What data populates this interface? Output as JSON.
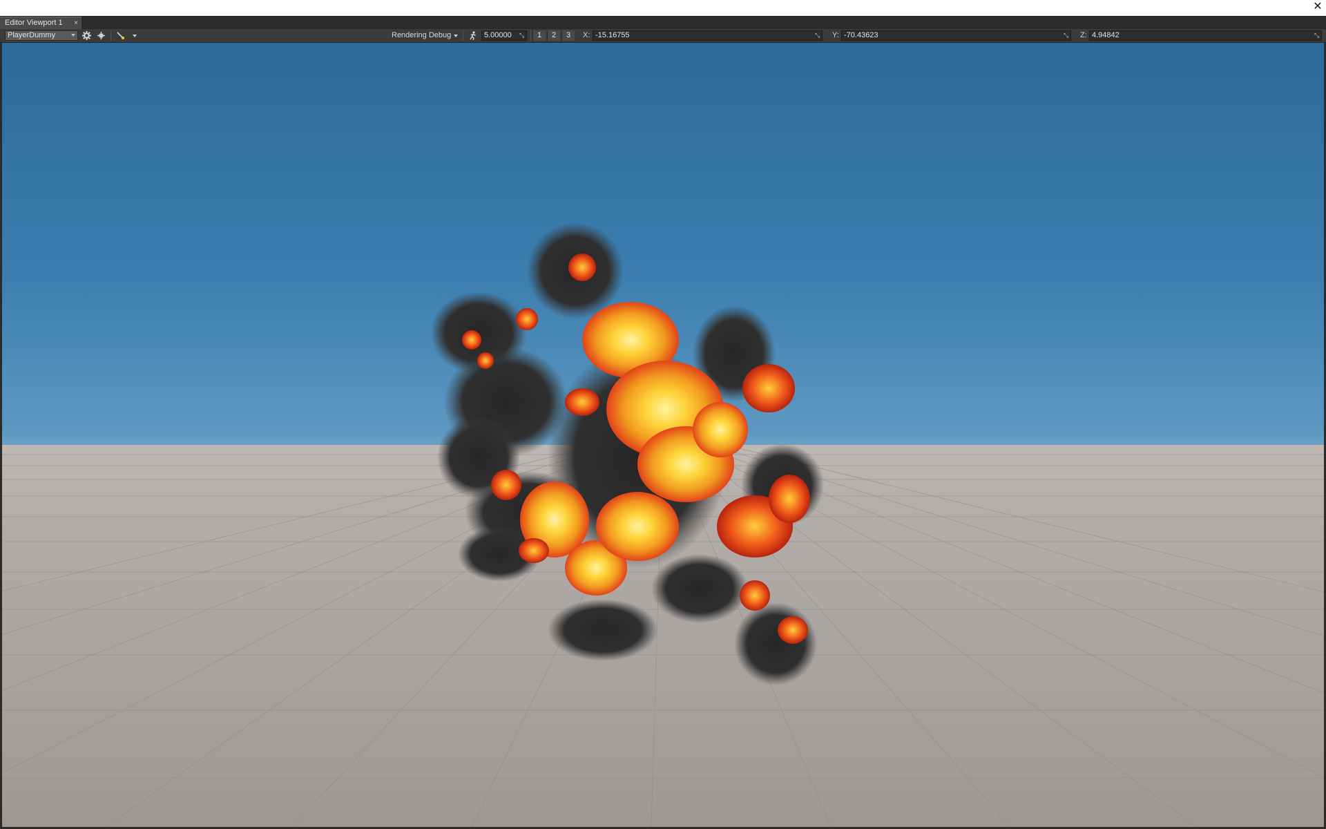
{
  "window": {
    "close_glyph": "✕"
  },
  "tabs": [
    {
      "label": "Editor Viewport 1",
      "close_glyph": "×"
    }
  ],
  "toolbar": {
    "camera_select": "PlayerDummy",
    "rendering_debug_label": "Rendering Debug",
    "speed_value": "5.00000",
    "view_buttons": [
      "1",
      "2",
      "3"
    ],
    "x_label": "X:",
    "x_value": "-15.16755",
    "y_label": "Y:",
    "y_value": "-70.43623",
    "z_label": "Z:",
    "z_value": "4.94842",
    "icons": [
      "gear-icon",
      "move-gizmo-icon",
      "brush-tool-icon",
      "speed-runner-icon",
      "expand-icon"
    ]
  },
  "colors": {
    "sky_top": "#2e6a9b",
    "horizon": "#b8cfd8",
    "ground": "#a8a6a3",
    "fire_core": "#ffd43a",
    "fire_edge": "#e2431a",
    "smoke": "#2a2a2a"
  }
}
